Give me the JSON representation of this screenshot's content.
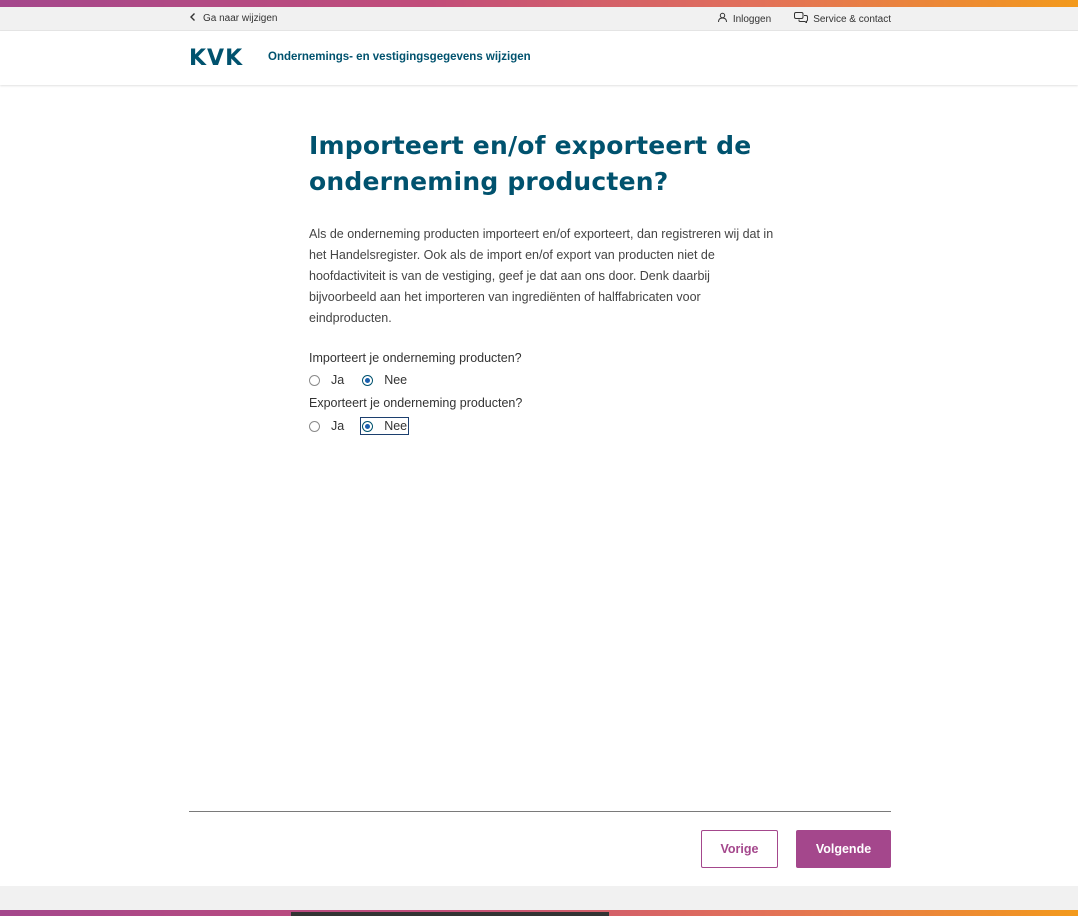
{
  "util_bar": {
    "back_label": "Ga naar wijzigen",
    "login_label": "Inloggen",
    "service_label": "Service & contact"
  },
  "header": {
    "logo_text": "KVK",
    "title": "Ondernemings- en vestigingsgegevens wijzigen"
  },
  "main": {
    "heading_line1": "Importeert en/of exporteert de",
    "heading_line2": "onderneming producten?",
    "intro": "Als de onderneming producten importeert en/of exporteert, dan registreren wij dat in het Handelsregister. Ook als de import en/of export van producten niet de hoofdactiviteit is van de vestiging, geef je dat aan ons door. Denk daarbij bijvoorbeeld aan het importeren van ingrediënten of halffabricaten voor eindproducten.",
    "q1": {
      "label": "Importeert je onderneming producten?",
      "options": [
        "Ja",
        "Nee"
      ],
      "selected": "Nee"
    },
    "q2": {
      "label": "Exporteert je onderneming producten?",
      "options": [
        "Ja",
        "Nee"
      ],
      "selected": "Nee"
    }
  },
  "nav": {
    "prev_label": "Vorige",
    "next_label": "Volgende"
  },
  "colors": {
    "brand_blue": "#00526e",
    "accent_purple": "#a4478c"
  }
}
